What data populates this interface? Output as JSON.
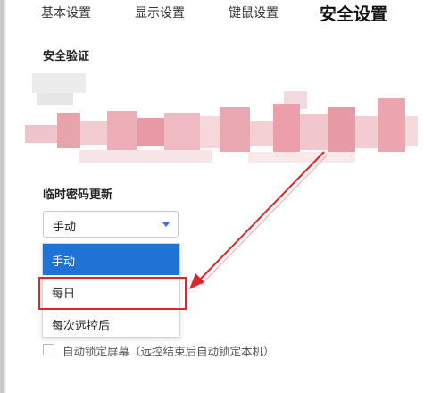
{
  "tabs": [
    {
      "label": "基本设置",
      "active": false
    },
    {
      "label": "显示设置",
      "active": false
    },
    {
      "label": "键鼠设置",
      "active": false
    },
    {
      "label": "安全设置",
      "active": true
    }
  ],
  "security_verification": {
    "title": "安全验证"
  },
  "temp_password": {
    "title": "临时密码更新",
    "selected": "手动",
    "options": [
      "手动",
      "每日",
      "每次远控后"
    ]
  },
  "auto_lock": {
    "label": "自动锁定屏幕（远控结束后自动锁定本机）",
    "checked": false
  },
  "colors": {
    "accent": "#1e73d4",
    "annotation": "#e0242c"
  }
}
